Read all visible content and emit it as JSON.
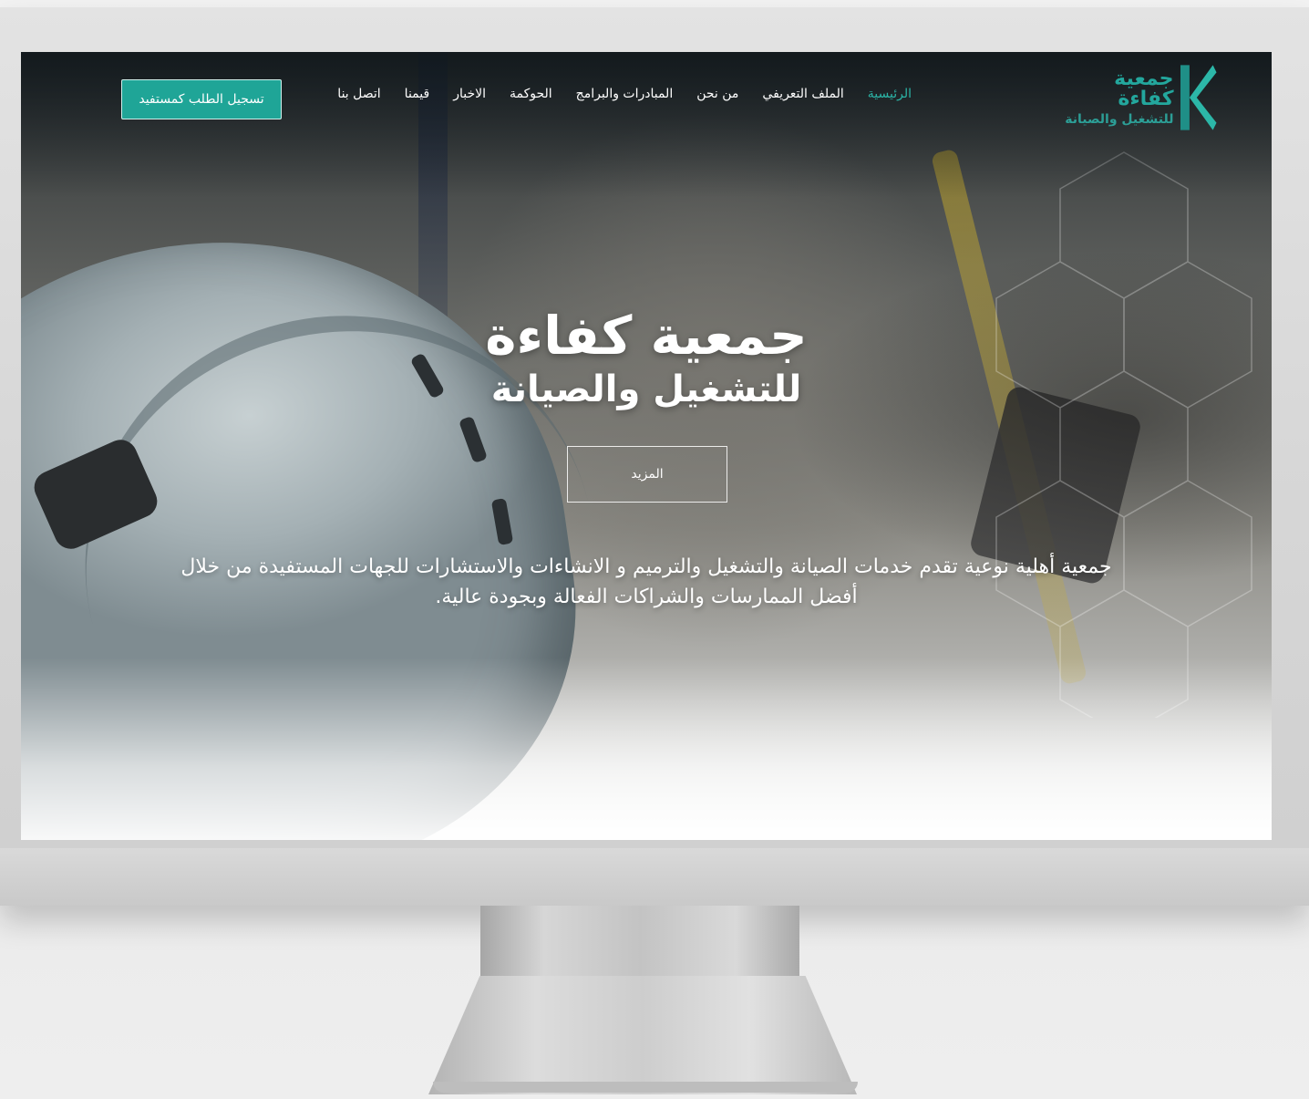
{
  "brand": {
    "line1": "جمعية كفاءة",
    "line2": "للتشغيل والصيانة",
    "accent_color": "#1fa597",
    "logo_icon": "k-logo-icon"
  },
  "nav": {
    "items": [
      {
        "label": "الرئيسية",
        "active": true
      },
      {
        "label": "الملف التعريفي"
      },
      {
        "label": "من نحن"
      },
      {
        "label": "المبادرات والبرامج"
      },
      {
        "label": "الحوكمة"
      },
      {
        "label": "الاخبار"
      },
      {
        "label": "قيمنا"
      },
      {
        "label": "اتصل بنا"
      }
    ],
    "cta_label": "تسجيل الطلب كمستفيد"
  },
  "hero": {
    "title_line1": "جمعية كفاءة",
    "title_line2": "للتشغيل والصيانة",
    "more_button": "المزيد",
    "description": "جمعية أهلية نوعية تقدم خدمات الصيانة والتشغيل والترميم و الانشاءات والاستشارات للجهات المستفيدة من خلال أفضل الممارسات والشراكات الفعالة وبجودة عالية."
  }
}
